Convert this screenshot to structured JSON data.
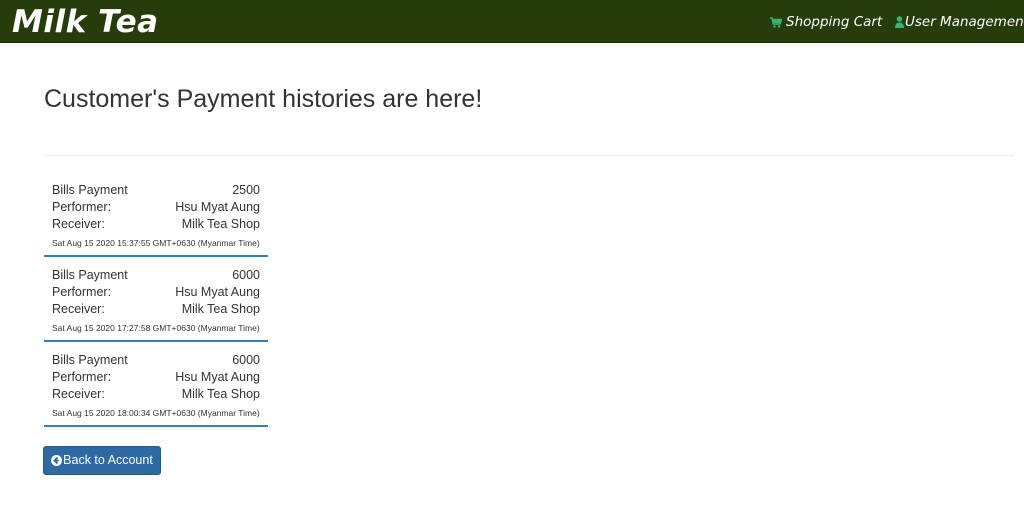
{
  "navbar": {
    "brand": "Milk Tea",
    "cart_label": "Shopping Cart",
    "user_label": "User Management"
  },
  "page": {
    "title": "Customer's Payment histories are here!"
  },
  "payments": [
    {
      "type": "Bills Payment",
      "amount": "2500",
      "performer_label": "Performer:",
      "performer": "Hsu Myat Aung",
      "receiver_label": "Receiver:",
      "receiver": "Milk Tea Shop",
      "time": "Sat Aug 15 2020 15:37:55 GMT+0630 (Myanmar Time)"
    },
    {
      "type": "Bills Payment",
      "amount": "6000",
      "performer_label": "Performer:",
      "performer": "Hsu Myat Aung",
      "receiver_label": "Receiver:",
      "receiver": "Milk Tea Shop",
      "time": "Sat Aug 15 2020 17:27:58 GMT+0630 (Myanmar Time)"
    },
    {
      "type": "Bills Payment",
      "amount": "6000",
      "performer_label": "Performer:",
      "performer": "Hsu Myat Aung",
      "receiver_label": "Receiver:",
      "receiver": "Milk Tea Shop",
      "time": "Sat Aug 15 2020 18:00:34 GMT+0630 (Myanmar Time)"
    }
  ],
  "back_button": {
    "label": "Back to Account"
  },
  "icons": {
    "cart": "shopping-cart-icon",
    "user": "user-icon",
    "back": "arrow-circle-left-icon"
  },
  "colors": {
    "navbar": "#243d0b",
    "accent": "#2f7fc1",
    "button": "#2d6aa3",
    "icon_green": "#3cb371"
  }
}
